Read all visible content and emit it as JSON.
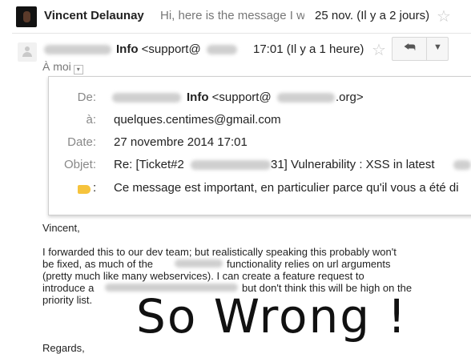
{
  "thread1": {
    "sender": "Vincent Delaunay",
    "snippet": "Hi, here is the message I w",
    "date": "25 nov. (Il y a 2 jours)",
    "star_icon": "star-outline-icon"
  },
  "thread2": {
    "sender_name": "Info",
    "sender_email": "<support@",
    "date": "17:01 (Il y a 1 heure)",
    "reply_icon": "reply-icon",
    "more_icon": "dropdown-caret-icon"
  },
  "to_me": "À moi",
  "details": {
    "from_label": "De:",
    "from_name": "Info",
    "from_email_start": "<support@",
    "from_email_end": ".org>",
    "to_label": "à:",
    "to_value": "quelques.centimes@gmail.com",
    "date_label": "Date:",
    "date_value": "27 novembre 2014 17:01",
    "subject_label": "Objet:",
    "subject_start": "Re: [Ticket#2",
    "subject_end": "31] Vulnerability : XSS in latest",
    "importance_label": ":",
    "importance_text": "Ce message est important, en particulier parce qu'il vous a été di"
  },
  "body": {
    "greeting": "Vincent,",
    "line1": "I forwarded this to our dev team; but realistically speaking this probably won't",
    "line2a": "be fixed, as much of the",
    "line2b": "functionality relies on url arguments",
    "line3": "(pretty much like many webservices). I can create a feature request to",
    "line4a": "introduce a",
    "line4b": "but don't think this will be high on the",
    "line5": "priority list.",
    "closing": "Regards,"
  },
  "overlay_text": "So Wrong !",
  "colors": {
    "star": "#c8c8c8",
    "important_tag": "#f6c33c",
    "label_gray": "#888888"
  }
}
